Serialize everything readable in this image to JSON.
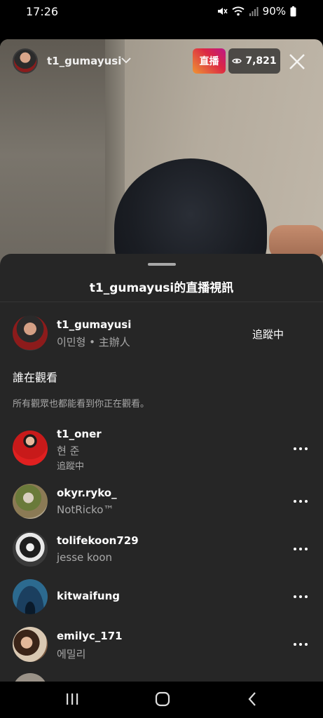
{
  "status_bar": {
    "time": "17:26",
    "battery": "90%"
  },
  "live": {
    "host_username": "t1_gumayusi",
    "live_label": "直播",
    "viewer_count": "7,821"
  },
  "sheet": {
    "title": "t1_gumayusi的直播視訊",
    "host": {
      "username": "t1_gumayusi",
      "subtitle": "이민형 • 主辦人",
      "follow_label": "追蹤中"
    },
    "section_title": "誰在觀看",
    "section_desc": "所有觀眾也都能看到你正在觀看。",
    "viewers": [
      {
        "username": "t1_oner",
        "name": "현 준",
        "status": "追蹤中"
      },
      {
        "username": "okyr.ryko_",
        "name": "NotRicko™",
        "status": ""
      },
      {
        "username": "tolifekoon729",
        "name": "jesse koon",
        "status": ""
      },
      {
        "username": "kitwaifung",
        "name": "",
        "status": ""
      },
      {
        "username": "emilyc_171",
        "name": "에밀리",
        "status": ""
      }
    ]
  },
  "colors": {
    "accent_live": "#dc2743",
    "sheet_bg": "#262626",
    "secondary_text": "#a8a8a8"
  },
  "icons": {
    "mute": "mute-icon",
    "wifi": "wifi-icon",
    "signal": "signal-icon",
    "battery": "battery-icon",
    "eye": "eye-icon",
    "close": "close-icon",
    "chevron": "chevron-down-icon",
    "more": "more-horizontal-icon",
    "nav_recents": "recents-icon",
    "nav_home": "home-icon",
    "nav_back": "back-icon"
  }
}
